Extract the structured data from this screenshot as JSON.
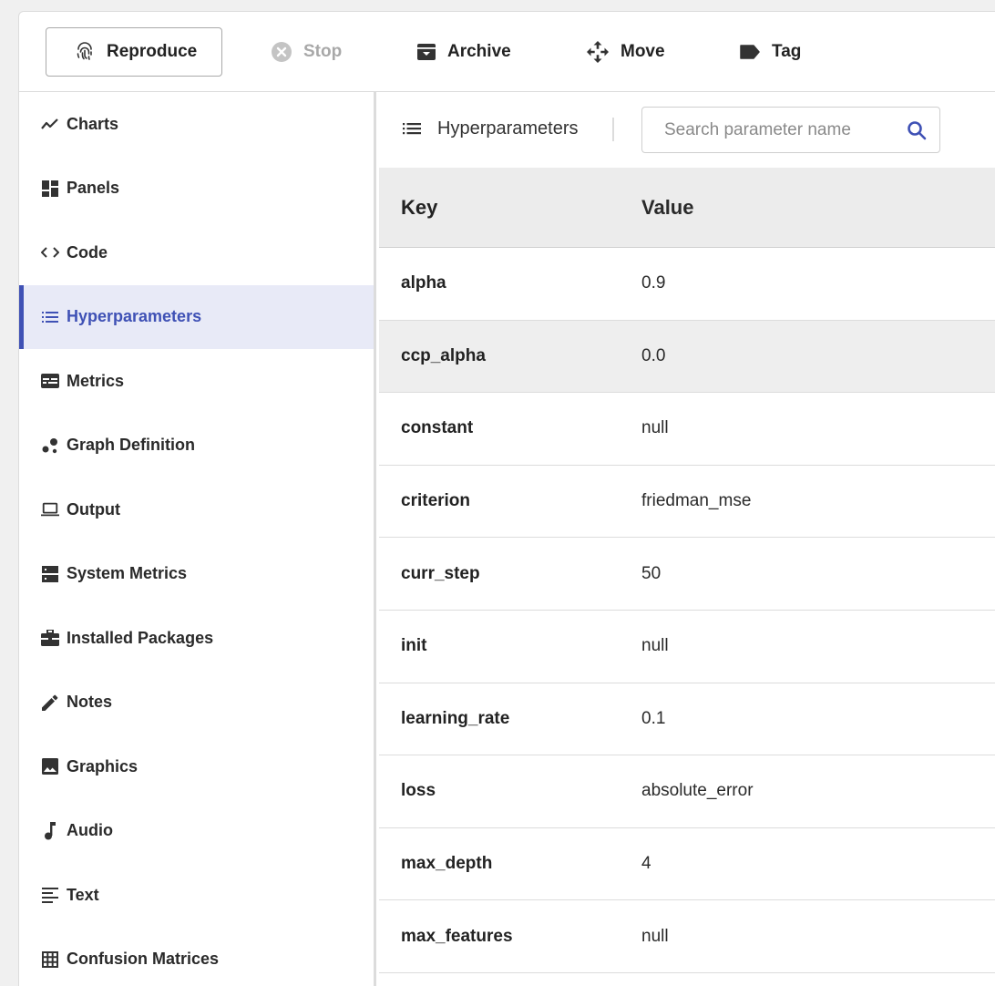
{
  "toolbar": {
    "reproduce": "Reproduce",
    "stop": "Stop",
    "archive": "Archive",
    "move": "Move",
    "tag": "Tag"
  },
  "sidebar": {
    "items": [
      {
        "label": "Charts",
        "icon": "chart-line-icon"
      },
      {
        "label": "Panels",
        "icon": "panels-icon"
      },
      {
        "label": "Code",
        "icon": "code-icon"
      },
      {
        "label": "Hyperparameters",
        "icon": "list-icon",
        "active": true
      },
      {
        "label": "Metrics",
        "icon": "metrics-icon"
      },
      {
        "label": "Graph Definition",
        "icon": "graph-icon"
      },
      {
        "label": "Output",
        "icon": "laptop-icon"
      },
      {
        "label": "System Metrics",
        "icon": "server-icon"
      },
      {
        "label": "Installed Packages",
        "icon": "briefcase-icon"
      },
      {
        "label": "Notes",
        "icon": "pencil-icon"
      },
      {
        "label": "Graphics",
        "icon": "image-icon"
      },
      {
        "label": "Audio",
        "icon": "music-note-icon"
      },
      {
        "label": "Text",
        "icon": "text-icon"
      },
      {
        "label": "Confusion Matrices",
        "icon": "grid-icon"
      }
    ]
  },
  "main": {
    "title": "Hyperparameters",
    "search_placeholder": "Search parameter name",
    "columns": {
      "key": "Key",
      "value": "Value"
    },
    "rows": [
      {
        "key": "alpha",
        "value": "0.9"
      },
      {
        "key": "ccp_alpha",
        "value": "0.0"
      },
      {
        "key": "constant",
        "value": "null"
      },
      {
        "key": "criterion",
        "value": "friedman_mse"
      },
      {
        "key": "curr_step",
        "value": "50"
      },
      {
        "key": "init",
        "value": "null"
      },
      {
        "key": "learning_rate",
        "value": "0.1"
      },
      {
        "key": "loss",
        "value": "absolute_error"
      },
      {
        "key": "max_depth",
        "value": "4"
      },
      {
        "key": "max_features",
        "value": "null"
      }
    ]
  },
  "colors": {
    "accent": "#3f51b5",
    "active_bg": "#e8eaf7",
    "header_bg": "#ececec",
    "highlight_row_bg": "#eeeeee",
    "disabled_text": "#a8a8a8"
  }
}
